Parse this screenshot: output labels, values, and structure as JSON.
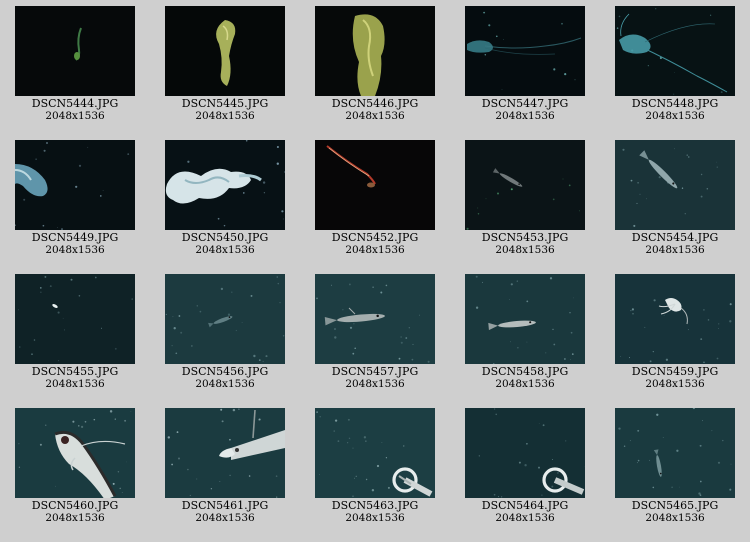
{
  "gallery": {
    "items": [
      {
        "filename": "DSCN5444.JPG",
        "dimensions": "2048x1536",
        "scene": "small-green-creature",
        "bg": "#06090a"
      },
      {
        "filename": "DSCN5445.JPG",
        "dimensions": "2048x1536",
        "scene": "siphonophore-yellow",
        "bg": "#050808"
      },
      {
        "filename": "DSCN5446.JPG",
        "dimensions": "2048x1536",
        "scene": "siphonophore-yellow-large",
        "bg": "#060909"
      },
      {
        "filename": "DSCN5447.JPG",
        "dimensions": "2048x1536",
        "scene": "cyan-jelly-tentacles",
        "bg": "#050c0f"
      },
      {
        "filename": "DSCN5448.JPG",
        "dimensions": "2048x1536",
        "scene": "cyan-shrimp",
        "bg": "#071214"
      },
      {
        "filename": "DSCN5449.JPG",
        "dimensions": "2048x1536",
        "scene": "blue-jelly-edge",
        "bg": "#071013"
      },
      {
        "filename": "DSCN5450.JPG",
        "dimensions": "2048x1536",
        "scene": "white-blob-colony",
        "bg": "#071115"
      },
      {
        "filename": "DSCN5452.JPG",
        "dimensions": "2048x1536",
        "scene": "red-streak-fish",
        "bg": "#070607"
      },
      {
        "filename": "DSCN5453.JPG",
        "dimensions": "2048x1536",
        "scene": "small-dark-fish",
        "bg": "#0b1417"
      },
      {
        "filename": "DSCN5454.JPG",
        "dimensions": "2048x1536",
        "scene": "pale-fish-diagonal",
        "bg": "#1a3338"
      },
      {
        "filename": "DSCN5455.JPG",
        "dimensions": "2048x1536",
        "scene": "tiny-white-speck",
        "bg": "#0f2226"
      },
      {
        "filename": "DSCN5456.JPG",
        "dimensions": "2048x1536",
        "scene": "faint-fish",
        "bg": "#1c3a3f"
      },
      {
        "filename": "DSCN5457.JPG",
        "dimensions": "2048x1536",
        "scene": "grey-fish-horizontal",
        "bg": "#1d3d42"
      },
      {
        "filename": "DSCN5458.JPG",
        "dimensions": "2048x1536",
        "scene": "grey-fish-small",
        "bg": "#1a383d"
      },
      {
        "filename": "DSCN5459.JPG",
        "dimensions": "2048x1536",
        "scene": "white-fish-up",
        "bg": "#17333a"
      },
      {
        "filename": "DSCN5460.JPG",
        "dimensions": "2048x1536",
        "scene": "big-fish-closeup",
        "bg": "#1a3b40"
      },
      {
        "filename": "DSCN5461.JPG",
        "dimensions": "2048x1536",
        "scene": "fish-with-rod",
        "bg": "#1b3b40"
      },
      {
        "filename": "DSCN5463.JPG",
        "dimensions": "2048x1536",
        "scene": "sampler-ring",
        "bg": "#1c3e43"
      },
      {
        "filename": "DSCN5464.JPG",
        "dimensions": "2048x1536",
        "scene": "sampler-ring-dark",
        "bg": "#142f34"
      },
      {
        "filename": "DSCN5465.JPG",
        "dimensions": "2048x1536",
        "scene": "faint-vertical-fish",
        "bg": "#1a3a3f"
      }
    ]
  }
}
